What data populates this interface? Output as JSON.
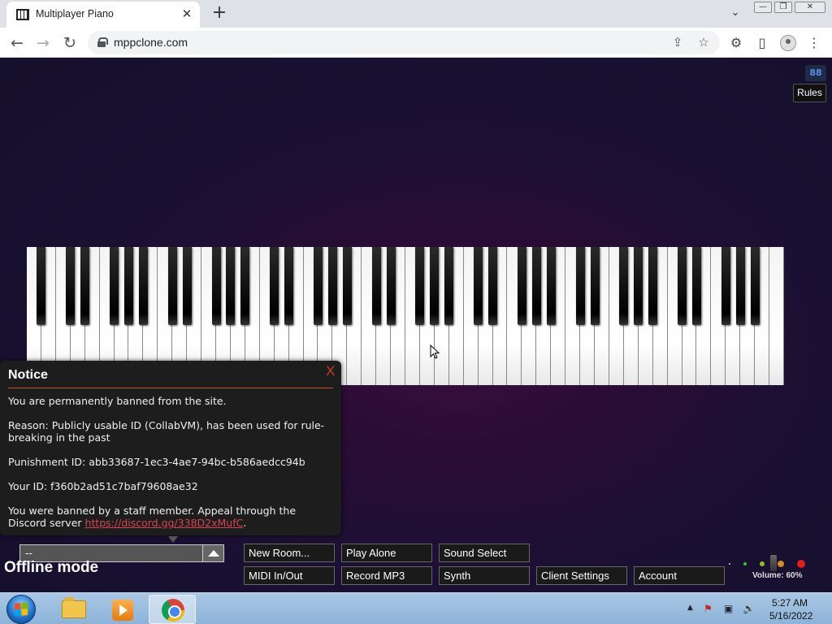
{
  "browser": {
    "tab_title": "Multiplayer Piano",
    "tab_close": "✕",
    "new_tab": "+",
    "tab_list": "⌄",
    "window_controls": {
      "minimize": "—",
      "restore": "❐",
      "close": "✕"
    },
    "nav": {
      "back": "←",
      "forward": "→",
      "reload": "↻"
    },
    "url": "mppclone.com",
    "toolbar_icons": {
      "share": "⇪",
      "bookmark": "☆",
      "extensions": "⚙",
      "side_panel": "▯",
      "menu": "⋮"
    }
  },
  "page": {
    "corner_icon_label": "88",
    "rules_label": "Rules",
    "offline_label": "Offline mode",
    "room_select_value": "--",
    "volume_label": "Volume: 60%",
    "volume_percent": 60
  },
  "notice": {
    "title": "Notice",
    "close": "X",
    "line1": "You are permanently banned from the site.",
    "line2": "Reason: Publicly usable ID (CollabVM), has been used for rule-breaking in the past",
    "line3": "Punishment ID: abb33687-1ec3-4ae7-94bc-b586aedcc94b",
    "line4": "Your ID: f360b2ad51c7baf79608ae32",
    "line5_prefix": "You were banned by a staff member. Appeal through the Discord server ",
    "line5_link": "https://discord.gg/338D2xMufC",
    "line5_suffix": "."
  },
  "buttons": {
    "new_room": "New Room...",
    "play_alone": "Play Alone",
    "sound_select": "Sound Select",
    "midi": "MIDI In/Out",
    "record": "Record MP3",
    "synth": "Synth",
    "client_settings": "Client Settings",
    "account": "Account"
  },
  "taskbar": {
    "time": "5:27 AM",
    "date": "5/16/2022",
    "tray": {
      "arrow": "▲",
      "flag": "⚑",
      "network": "▣",
      "speaker": "🔊"
    }
  },
  "colors": {
    "link": "#d64550",
    "notice_close": "#cc3a1e",
    "volume_dots": [
      "#cfcfcf",
      "#3fbf2f",
      "#8fbf2f",
      "#d28a2a",
      "#e21b1b"
    ]
  }
}
